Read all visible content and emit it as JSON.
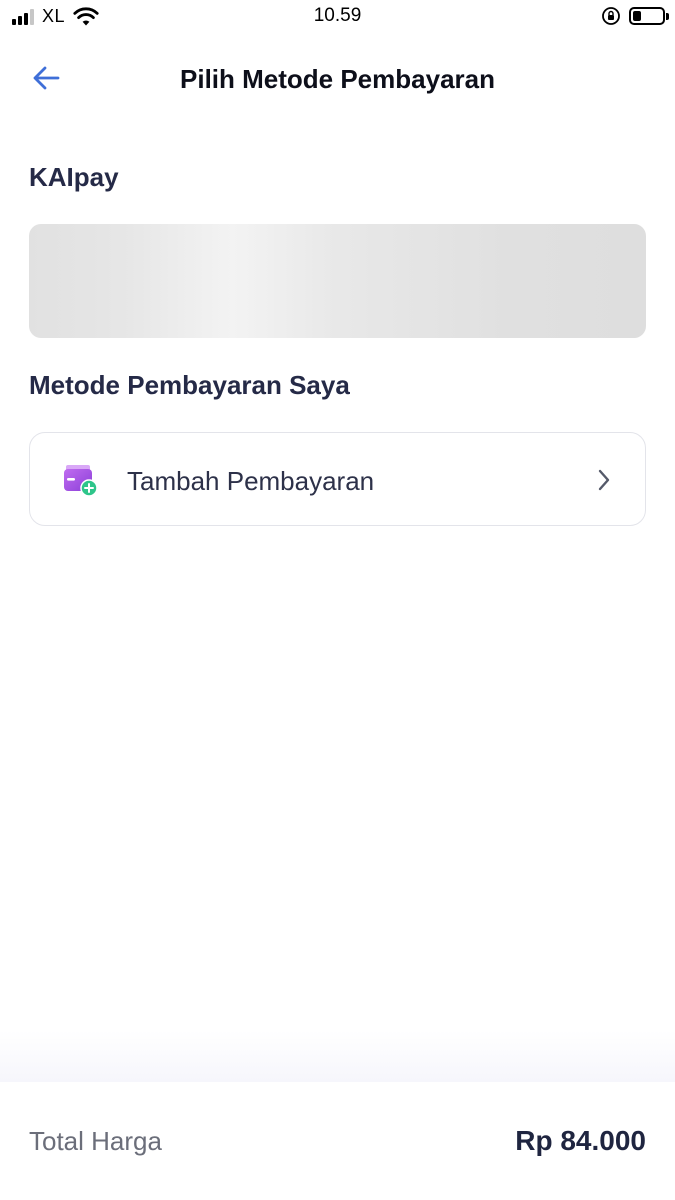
{
  "status_bar": {
    "carrier": "XL",
    "time": "10.59",
    "signal_bars_active": 3,
    "signal_bars_total": 4,
    "battery_level": 0.3
  },
  "header": {
    "title": "Pilih Metode Pembayaran",
    "back_icon": "arrow-left-icon"
  },
  "kaipay": {
    "section_title": "KAIpay"
  },
  "my_methods": {
    "section_title": "Metode Pembayaran Saya",
    "add_label": "Tambah Pembayaran",
    "add_icon": "wallet-add-icon",
    "chevron_icon": "chevron-right-icon"
  },
  "footer": {
    "total_label": "Total Harga",
    "total_value": "Rp 84.000"
  },
  "colors": {
    "accent": "#3f6fd8",
    "wallet_purple": "#a24de6",
    "plus_green": "#2ec58a",
    "text_dark": "#252a47"
  }
}
